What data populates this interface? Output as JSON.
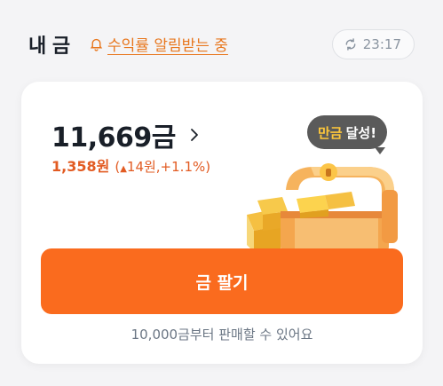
{
  "header": {
    "title": "내 금",
    "alert_link": "수익률 알림받는 중",
    "refresh_time": "23:17"
  },
  "card": {
    "amount": "11,669금",
    "profit": {
      "won": "1,358원",
      "open": "(",
      "triangle": "▲",
      "change": "14원,+1.1%)"
    },
    "bubble": {
      "highlight": "만금",
      "rest": "달성!"
    },
    "sell_button": "금 팔기",
    "note": "10,000금부터 판매할 수 있어요"
  },
  "colors": {
    "accent_orange": "#fa6b1e",
    "profit_red": "#e25b22",
    "alert_orange": "#e8771e",
    "bubble_bg": "#5a5a5a",
    "bubble_highlight": "#ffc83a"
  },
  "icons": {
    "alert": "bell-icon",
    "refresh": "refresh-icon",
    "amount_arrow": "chevron-right-icon",
    "illustration": "treasure-chest-icon"
  }
}
